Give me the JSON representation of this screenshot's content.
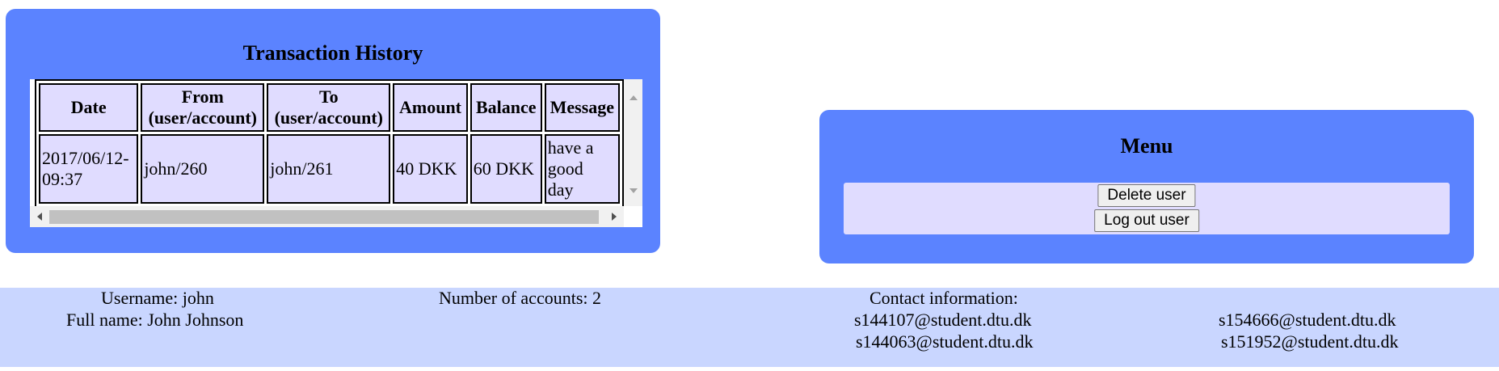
{
  "transactions": {
    "title": "Transaction History",
    "columns": [
      "Date",
      "From (user/account)",
      "To (user/account)",
      "Amount",
      "Balance",
      "Message"
    ],
    "header_lines": {
      "date": "Date",
      "from_1": "From",
      "from_2": "(user/account)",
      "to_1": "To",
      "to_2": "(user/account)",
      "amount": "Amount",
      "balance": "Balance",
      "message": "Message"
    },
    "rows": [
      {
        "date_1": "2017/06/12-",
        "date_2": "09:37",
        "from": "john/260",
        "to": "john/261",
        "amount": "40 DKK",
        "balance": "60 DKK",
        "message_1": "have a",
        "message_2": "good",
        "message_3": "day"
      }
    ]
  },
  "menu": {
    "title": "Menu",
    "delete_label": "Delete user",
    "logout_label": "Log out user"
  },
  "footer": {
    "username": "Username: john",
    "fullname": "Full name: John Johnson",
    "accounts": "Number of accounts: 2",
    "contact_label": "Contact information:",
    "emails": [
      "s144107@student.dtu.dk",
      "s154666@student.dtu.dk",
      "s144063@student.dtu.dk",
      "s151952@student.dtu.dk"
    ]
  },
  "colors": {
    "panel": "#5b83ff",
    "cell": "#e0dcff",
    "footer": "#c9d6ff"
  }
}
